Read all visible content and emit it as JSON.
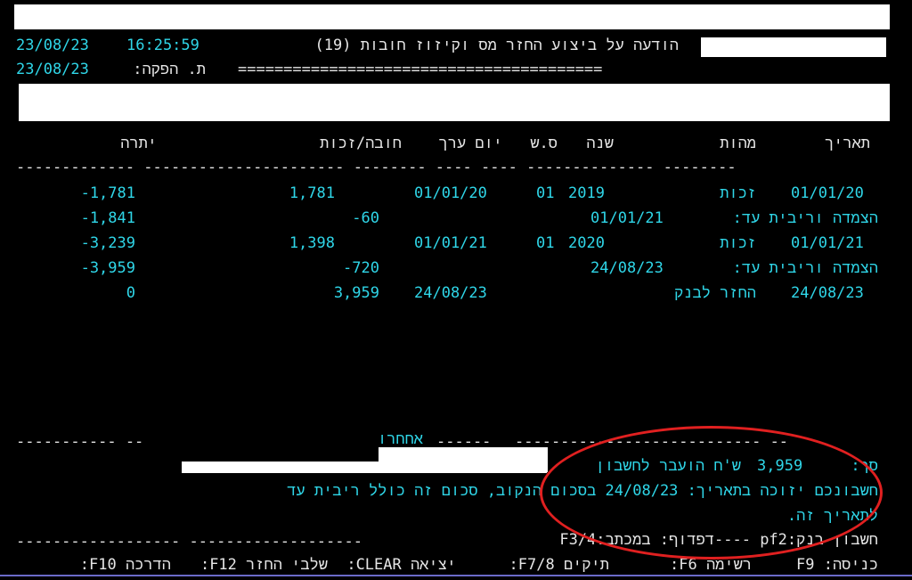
{
  "header": {
    "date": "23/08/23",
    "time": "16:25:59",
    "title": "הודעה על ביצוע החזר מס וקיזוז חובות (19)",
    "issue_label": "ת. הפקה:",
    "issue_date": "23/08/23",
    "title_underline": "========================================"
  },
  "table": {
    "columns": {
      "date": "תאריך",
      "type": "מהות",
      "year": "שנה",
      "ss": "ס.ש",
      "value_date": "יום ערך",
      "debit_credit": "חובה/זכות",
      "balance": "יתרה"
    },
    "rows": [
      {
        "date": "01/01/20",
        "type": "זכות",
        "ss": "01",
        "year": "2019",
        "value_date": "01/01/20",
        "amount": "1,781",
        "balance": "-1,781"
      },
      {
        "label": "הצמדה וריבית עד:",
        "label_date": "01/01/21",
        "amount": "-60",
        "balance": "-1,841"
      },
      {
        "date": "01/01/21",
        "type": "זכות",
        "ss": "01",
        "year": "2020",
        "value_date": "01/01/21",
        "amount": "1,398",
        "balance": "-3,239"
      },
      {
        "label": "הצמדה וריבית עד:",
        "label_date": "24/08/23",
        "amount": "-720",
        "balance": "-3,959"
      },
      {
        "date": "24/08/23",
        "type": "החזר לבנק",
        "value_date": "24/08/23",
        "amount": "3,959",
        "balance": "0"
      }
    ]
  },
  "footer": {
    "middle_label": "אחחרו",
    "sum_label": "סך:",
    "sum_value": "3,959",
    "sum_text": "ש'ח הועבר לחשבון",
    "line2": "חשבונכם יזוכה בתאריך: 24/08/23 בסכום הנקוב, סכום זה כולל ריבית עד",
    "line3": "לתאריך זה.",
    "account_line": "חשבון בנק:pf2 ----דפדוף: במכתב:F3/4"
  },
  "fkeys": {
    "f9": "כניסה: F9",
    "f6": "רשימה F6:",
    "f78": "תיקים F7/8:",
    "clear": "יציאה CLEAR:",
    "f12": "שלבי החזר F12:",
    "f10": "הדרכה F10:"
  },
  "colors": {
    "cyan": "#2fd6e8",
    "white_text": "#e6e6e6",
    "annotation_red": "#e02020"
  }
}
